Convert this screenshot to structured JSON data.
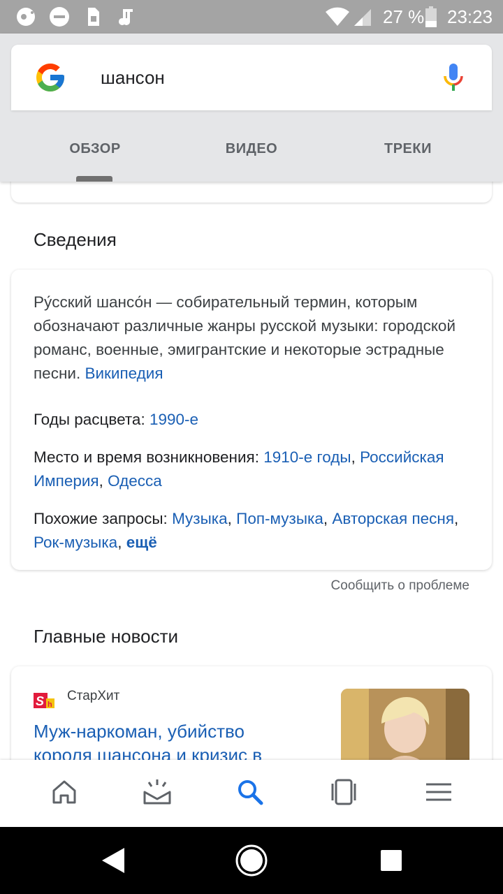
{
  "status_bar": {
    "battery_percent": "27 %",
    "time": "23:23",
    "icons": [
      "cast-icon",
      "do-not-disturb-icon",
      "sim-icon",
      "music-note-icon",
      "wifi-icon",
      "signal-icon",
      "battery-icon"
    ]
  },
  "search": {
    "query": "шансон"
  },
  "tabs": [
    {
      "label": "ОБЗОР",
      "active": true
    },
    {
      "label": "ВИДЕО",
      "active": false
    },
    {
      "label": "ТРЕКИ",
      "active": false
    }
  ],
  "info": {
    "section_title": "Сведения",
    "description": "Ру́сский шансо́н — собирательный термин, которым обозначают различные жанры русской музыки: городской романс, военные, эмигрантские и некоторые эстрадные песни.",
    "source_link": "Википедия",
    "peak_label": "Годы расцвета:",
    "peak_value": "1990-е",
    "origin_label": "Место и время возникновения:",
    "origin_links": [
      "1910-е годы",
      "Российская Империя",
      "Одесса"
    ],
    "related_label": "Похожие запросы:",
    "related_links": [
      "Музыка",
      "Поп-музыка",
      "Авторская песня",
      "Рок-музыка"
    ],
    "more_label": "ещё"
  },
  "report_problem": "Сообщить о проблеме",
  "news": {
    "section_title": "Главные новости",
    "source": "СтарХит",
    "headline": "Муж-наркоман, убийство короля шансона и кризис в"
  },
  "colors": {
    "link": "#1a5fb4",
    "status_bar": "#a4a4a4",
    "header_bg": "#e5e6e8"
  }
}
